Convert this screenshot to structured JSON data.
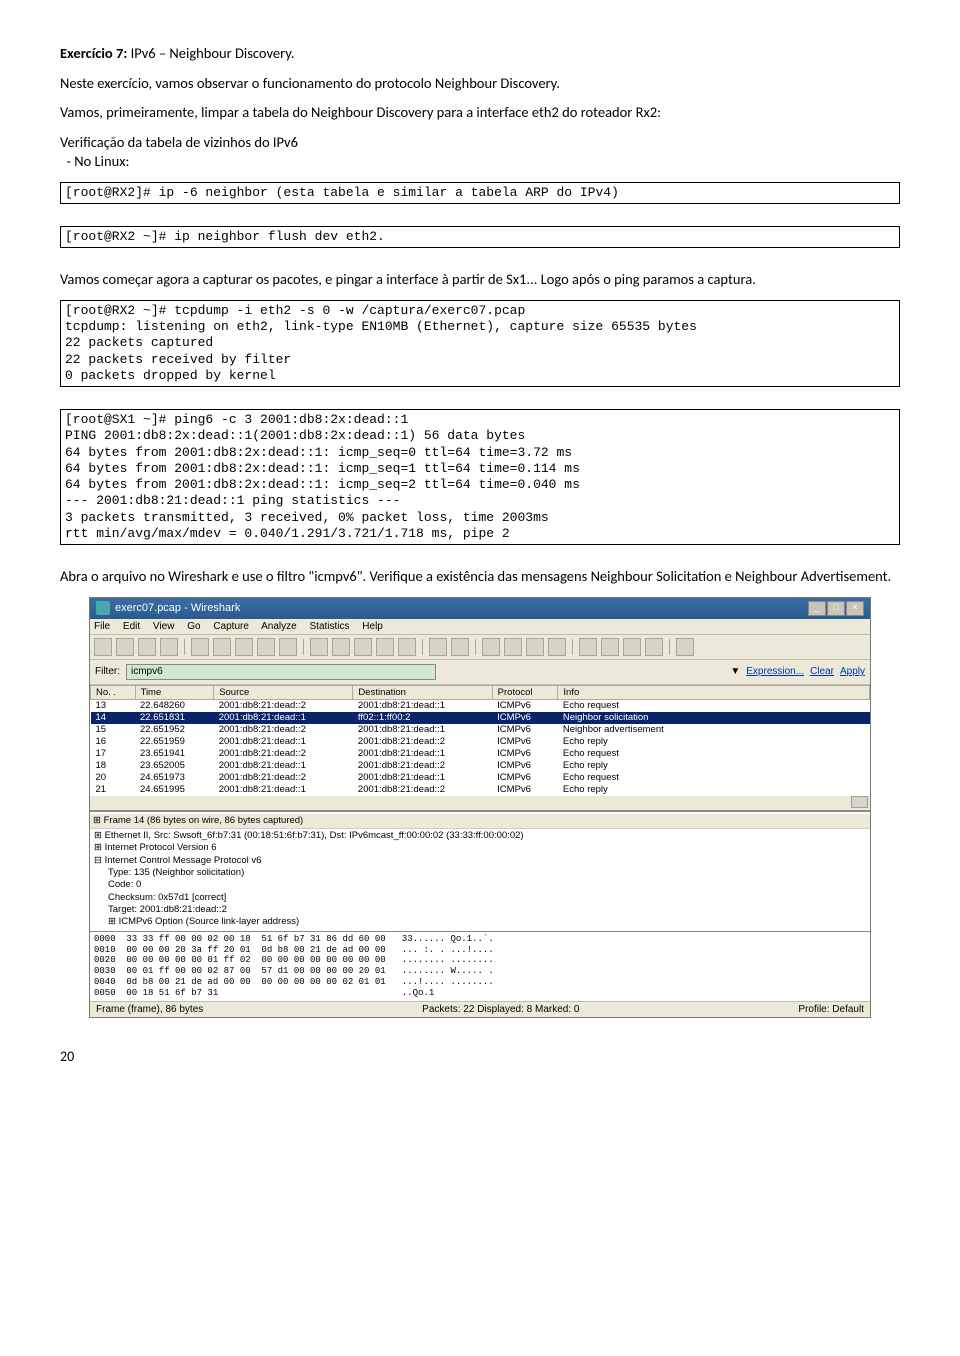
{
  "title_prefix": "Exercício 7:",
  "title_rest": "  IPv6 – Neighbour Discovery.",
  "p1": "Neste exercício, vamos observar o funcionamento do protocolo Neighbour Discovery.",
  "p2": "Vamos, primeiramente, limpar a tabela do Neighbour Discovery para a interface eth2 do roteador Rx2:",
  "p3": "Verificação da tabela de vizinhos do IPv6",
  "p4": "  - No Linux:",
  "code1": "[root@RX2]# ip -6 neighbor (esta tabela e similar a tabela ARP do IPv4)",
  "code2": "[root@RX2 ~]# ip neighbor flush dev eth2.",
  "p5": "Vamos começar agora a capturar os pacotes, e pingar a interface à partir de Sx1... Logo após o ping paramos a captura.",
  "code3": "[root@RX2 ~]# tcpdump -i eth2 -s 0 -w /captura/exerc07.pcap\ntcpdump: listening on eth2, link-type EN10MB (Ethernet), capture size 65535 bytes\n22 packets captured\n22 packets received by filter\n0 packets dropped by kernel",
  "code4": "[root@SX1 ~]# ping6 -c 3 2001:db8:2x:dead::1\nPING 2001:db8:2x:dead::1(2001:db8:2x:dead::1) 56 data bytes\n64 bytes from 2001:db8:2x:dead::1: icmp_seq=0 ttl=64 time=3.72 ms\n64 bytes from 2001:db8:2x:dead::1: icmp_seq=1 ttl=64 time=0.114 ms\n64 bytes from 2001:db8:2x:dead::1: icmp_seq=2 ttl=64 time=0.040 ms\n--- 2001:db8:21:dead::1 ping statistics ---\n3 packets transmitted, 3 received, 0% packet loss, time 2003ms\nrtt min/avg/max/mdev = 0.040/1.291/3.721/1.718 ms, pipe 2",
  "p6": "Abra o arquivo no Wireshark e use o filtro \"icmpv6\". Verifique a existência das mensagens Neighbour Solicitation e Neighbour Advertisement.",
  "page_num": "20",
  "wireshark": {
    "title": "exerc07.pcap - Wireshark",
    "menu": [
      "File",
      "Edit",
      "View",
      "Go",
      "Capture",
      "Analyze",
      "Statistics",
      "Help"
    ],
    "filter_label": "Filter:",
    "filter_value": "icmpv6",
    "filter_links": [
      "Expression...",
      "Clear",
      "Apply"
    ],
    "cols": [
      "No. .",
      "Time",
      "Source",
      "Destination",
      "Protocol",
      "Info"
    ],
    "rows": [
      {
        "no": "13",
        "time": "22.648260",
        "src": "2001:db8:21:dead::2",
        "dst": "2001:db8:21:dead::1",
        "proto": "ICMPv6",
        "info": "Echo request"
      },
      {
        "no": "14",
        "time": "22.651831",
        "src": "2001:db8:21:dead::1",
        "dst": "ff02::1:ff00:2",
        "proto": "ICMPv6",
        "info": "Neighbor solicitation",
        "sel": true
      },
      {
        "no": "15",
        "time": "22.651952",
        "src": "2001:db8:21:dead::2",
        "dst": "2001:db8:21:dead::1",
        "proto": "ICMPv6",
        "info": "Neighbor advertisement"
      },
      {
        "no": "16",
        "time": "22.651959",
        "src": "2001:db8:21:dead::1",
        "dst": "2001:db8:21:dead::2",
        "proto": "ICMPv6",
        "info": "Echo reply"
      },
      {
        "no": "17",
        "time": "23.651941",
        "src": "2001:db8:21:dead::2",
        "dst": "2001:db8:21:dead::1",
        "proto": "ICMPv6",
        "info": "Echo request"
      },
      {
        "no": "18",
        "time": "23.652005",
        "src": "2001:db8:21:dead::1",
        "dst": "2001:db8:21:dead::2",
        "proto": "ICMPv6",
        "info": "Echo reply"
      },
      {
        "no": "20",
        "time": "24.651973",
        "src": "2001:db8:21:dead::2",
        "dst": "2001:db8:21:dead::1",
        "proto": "ICMPv6",
        "info": "Echo request"
      },
      {
        "no": "21",
        "time": "24.651995",
        "src": "2001:db8:21:dead::1",
        "dst": "2001:db8:21:dead::2",
        "proto": "ICMPv6",
        "info": "Echo reply"
      }
    ],
    "detail": {
      "hdr": "Frame 14 (86 bytes on wire, 86 bytes captured)",
      "l1": "⊞ Ethernet II, Src: Swsoft_6f:b7:31 (00:18:51:6f:b7:31), Dst: IPv6mcast_ff:00:00:02 (33:33:ff:00:00:02)",
      "l2": "⊞ Internet Protocol Version 6",
      "l3": "⊟ Internet Control Message Protocol v6",
      "l3a": "Type: 135 (Neighbor solicitation)",
      "l3b": "Code: 0",
      "l3c": "Checksum: 0x57d1 [correct]",
      "l3d": "Target: 2001:db8:21:dead::2",
      "l3e": "⊞ ICMPv6 Option (Source link-layer address)"
    },
    "hex": "0000  33 33 ff 00 00 02 00 18  51 6f b7 31 86 dd 60 00   33...... Qo.1..`.\n0010  00 00 00 20 3a ff 20 01  0d b8 00 21 de ad 00 00   ... :. . ...!....\n0020  00 00 00 00 00 01 ff 02  00 00 00 00 00 00 00 00   ........ ........\n0030  00 01 ff 00 00 02 87 00  57 d1 00 00 00 00 20 01   ........ W..... .\n0040  0d b8 00 21 de ad 00 00  00 00 00 00 00 02 01 01   ...!.... ........\n0050  00 18 51 6f b7 31                                  ..Qo.1",
    "status_left": "Frame (frame), 86 bytes",
    "status_mid": "Packets: 22 Displayed: 8 Marked: 0",
    "status_right": "Profile: Default"
  }
}
